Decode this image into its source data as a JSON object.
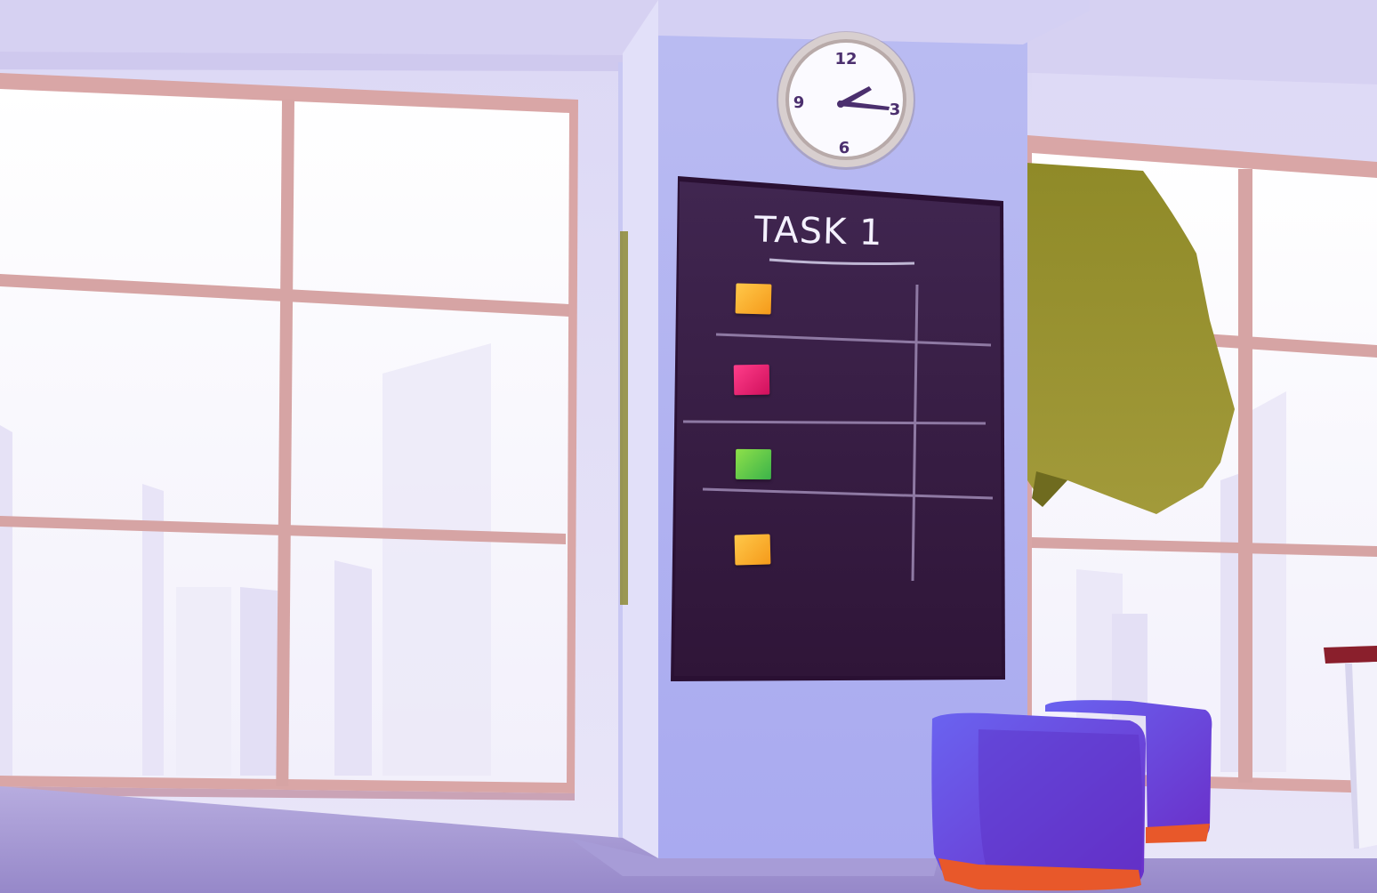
{
  "board": {
    "title": "TASK 1",
    "notes": [
      {
        "name": "sticky-note-orange",
        "color": "#f7a829"
      },
      {
        "name": "sticky-note-pink",
        "color": "#e8206f"
      },
      {
        "name": "sticky-note-green",
        "color": "#5ccb44"
      },
      {
        "name": "sticky-note-orange",
        "color": "#f7a829"
      }
    ]
  },
  "clock": {
    "numerals": {
      "twelve": "12",
      "three": "3",
      "six": "6",
      "nine": "9"
    }
  },
  "colors": {
    "wall": "#e7e4f7",
    "pillar": "#aeb0ee",
    "board": "#3a1d45",
    "floor": "#a89ad9",
    "ottoman": "#6b4de0",
    "tree": "#8e8a2d",
    "window_frame": "#d9a6a6"
  }
}
